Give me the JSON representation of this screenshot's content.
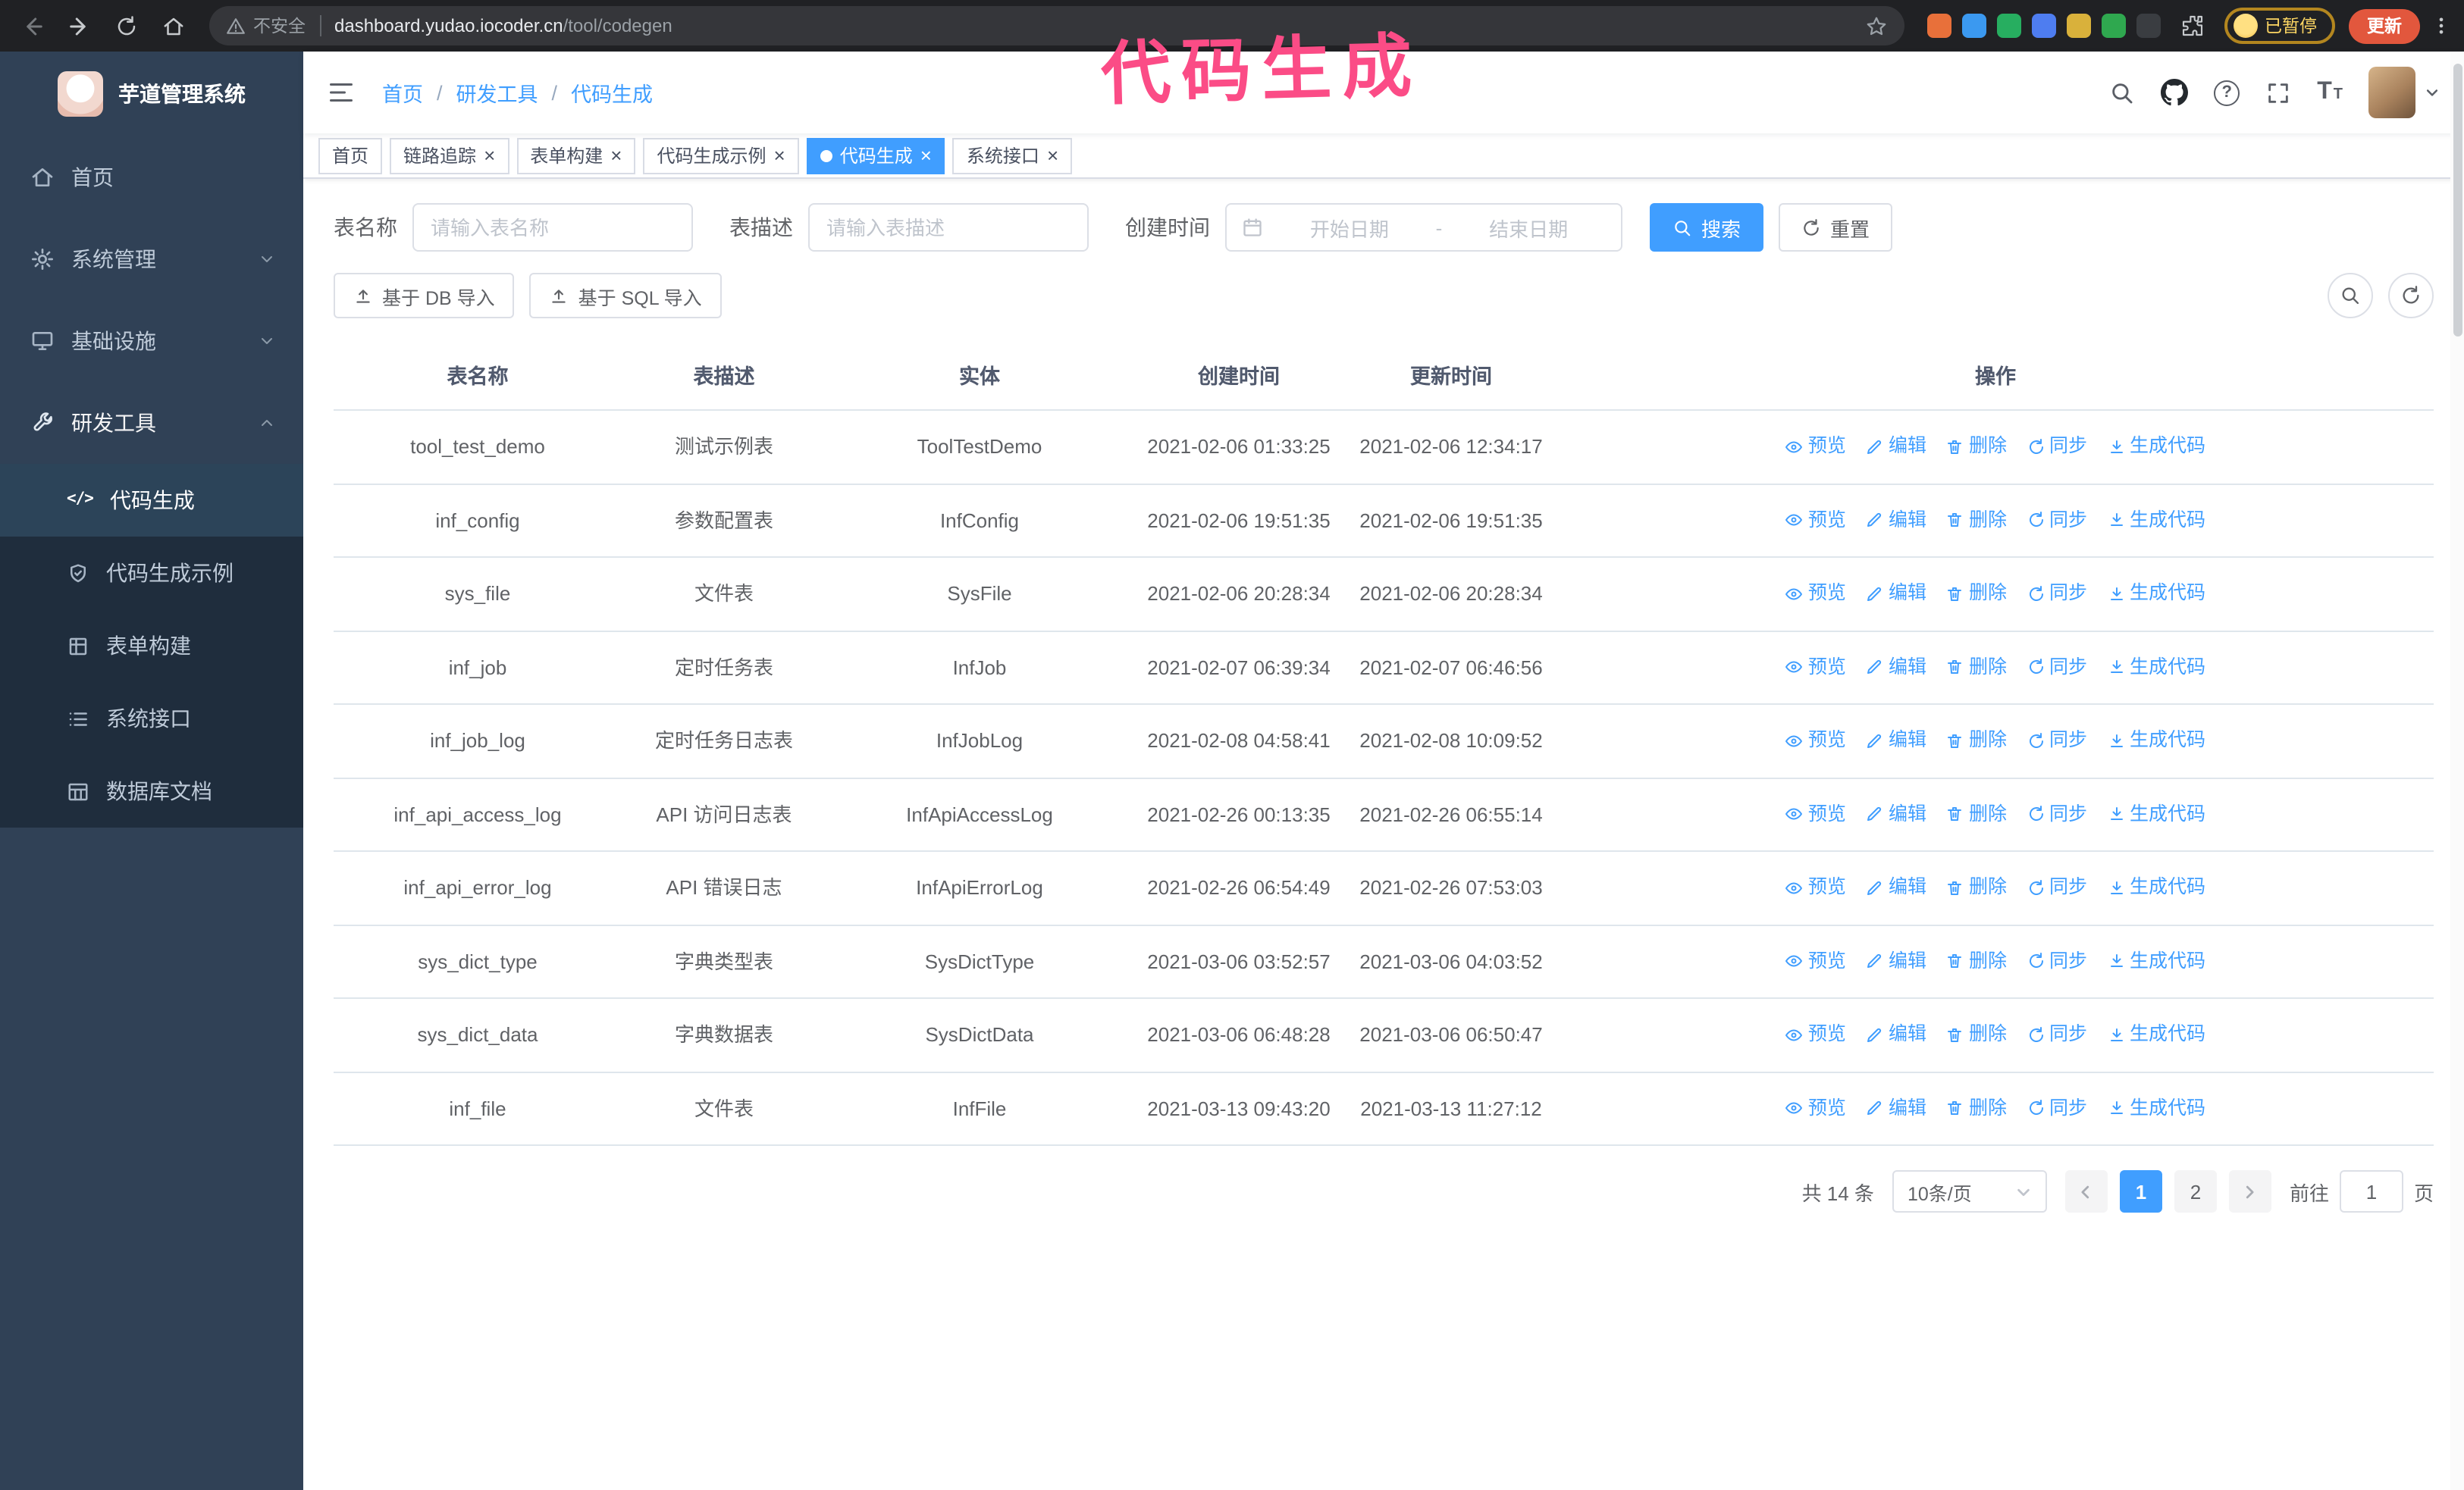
{
  "browser": {
    "security_label": "不安全",
    "url_domain": "dashboard.yudao.iocoder.cn",
    "url_path": "/tool/codegen",
    "paused_label": "已暂停",
    "update_label": "更新",
    "extensions": [
      "#e8703a",
      "#3b99f0",
      "#27ae60",
      "#4e7df0",
      "#d9b13b",
      "#2fa84f",
      "#3a3d41"
    ]
  },
  "annotation": {
    "text": "代码生成"
  },
  "sidebar": {
    "logo_title": "芋道管理系统",
    "menu": [
      {
        "label": "首页",
        "icon": "home"
      },
      {
        "label": "系统管理",
        "icon": "gear",
        "chevron": "down"
      },
      {
        "label": "基础设施",
        "icon": "monitor",
        "chevron": "down"
      },
      {
        "label": "研发工具",
        "icon": "wrench",
        "chevron": "up",
        "open": true,
        "children": [
          {
            "label": "代码生成",
            "icon": "code",
            "active": true
          },
          {
            "label": "代码生成示例",
            "icon": "shield"
          },
          {
            "label": "表单构建",
            "icon": "grid"
          },
          {
            "label": "系统接口",
            "icon": "list"
          },
          {
            "label": "数据库文档",
            "icon": "table"
          }
        ]
      }
    ]
  },
  "header": {
    "breadcrumb": [
      "首页",
      "研发工具",
      "代码生成"
    ],
    "breadcrumb_separator": "/"
  },
  "tabs": [
    {
      "label": "首页",
      "closable": false,
      "active": false
    },
    {
      "label": "链路追踪",
      "closable": true,
      "active": false
    },
    {
      "label": "表单构建",
      "closable": true,
      "active": false
    },
    {
      "label": "代码生成示例",
      "closable": true,
      "active": false
    },
    {
      "label": "代码生成",
      "closable": true,
      "active": true
    },
    {
      "label": "系统接口",
      "closable": true,
      "active": false
    }
  ],
  "filters": {
    "table_name_label": "表名称",
    "table_name_placeholder": "请输入表名称",
    "table_desc_label": "表描述",
    "table_desc_placeholder": "请输入表描述",
    "create_time_label": "创建时间",
    "date_start_placeholder": "开始日期",
    "date_separator": "-",
    "date_end_placeholder": "结束日期",
    "search_label": "搜索",
    "reset_label": "重置"
  },
  "toolbar": {
    "import_db_label": "基于 DB 导入",
    "import_sql_label": "基于 SQL 导入"
  },
  "table": {
    "columns": [
      "表名称",
      "表描述",
      "实体",
      "创建时间",
      "更新时间",
      "操作"
    ],
    "actions": [
      "预览",
      "编辑",
      "删除",
      "同步",
      "生成代码"
    ],
    "rows": [
      {
        "name": "tool_test_demo",
        "desc": "测试示例表",
        "entity": "ToolTestDemo",
        "created": "2021-02-06 01:33:25",
        "updated": "2021-02-06 12:34:17"
      },
      {
        "name": "inf_config",
        "desc": "参数配置表",
        "entity": "InfConfig",
        "created": "2021-02-06 19:51:35",
        "updated": "2021-02-06 19:51:35"
      },
      {
        "name": "sys_file",
        "desc": "文件表",
        "entity": "SysFile",
        "created": "2021-02-06 20:28:34",
        "updated": "2021-02-06 20:28:34"
      },
      {
        "name": "inf_job",
        "desc": "定时任务表",
        "entity": "InfJob",
        "created": "2021-02-07 06:39:34",
        "updated": "2021-02-07 06:46:56"
      },
      {
        "name": "inf_job_log",
        "desc": "定时任务日志表",
        "entity": "InfJobLog",
        "created": "2021-02-08 04:58:41",
        "updated": "2021-02-08 10:09:52"
      },
      {
        "name": "inf_api_access_log",
        "desc": "API 访问日志表",
        "entity": "InfApiAccessLog",
        "created": "2021-02-26 00:13:35",
        "updated": "2021-02-26 06:55:14"
      },
      {
        "name": "inf_api_error_log",
        "desc": "API 错误日志",
        "entity": "InfApiErrorLog",
        "created": "2021-02-26 06:54:49",
        "updated": "2021-02-26 07:53:03"
      },
      {
        "name": "sys_dict_type",
        "desc": "字典类型表",
        "entity": "SysDictType",
        "created": "2021-03-06 03:52:57",
        "updated": "2021-03-06 04:03:52"
      },
      {
        "name": "sys_dict_data",
        "desc": "字典数据表",
        "entity": "SysDictData",
        "created": "2021-03-06 06:48:28",
        "updated": "2021-03-06 06:50:47"
      },
      {
        "name": "inf_file",
        "desc": "文件表",
        "entity": "InfFile",
        "created": "2021-03-13 09:43:20",
        "updated": "2021-03-13 11:27:12"
      }
    ]
  },
  "pagination": {
    "total_text": "共 14 条",
    "page_size": "10条/页",
    "pages": [
      "1",
      "2"
    ],
    "active_page": "1",
    "goto_label": "前往",
    "goto_value": "1",
    "goto_unit": "页"
  },
  "colors": {
    "accent": "#409eff",
    "sidebar_bg": "#304156",
    "submenu_bg": "#1f2d3d",
    "active_subitem_bg": "#2c4459",
    "annotation_pink": "#fb4c86",
    "update_button": "#e2573d",
    "paused_text": "#fdd663",
    "chrome_bg": "#202124",
    "table_border": "#dfe6ec"
  }
}
